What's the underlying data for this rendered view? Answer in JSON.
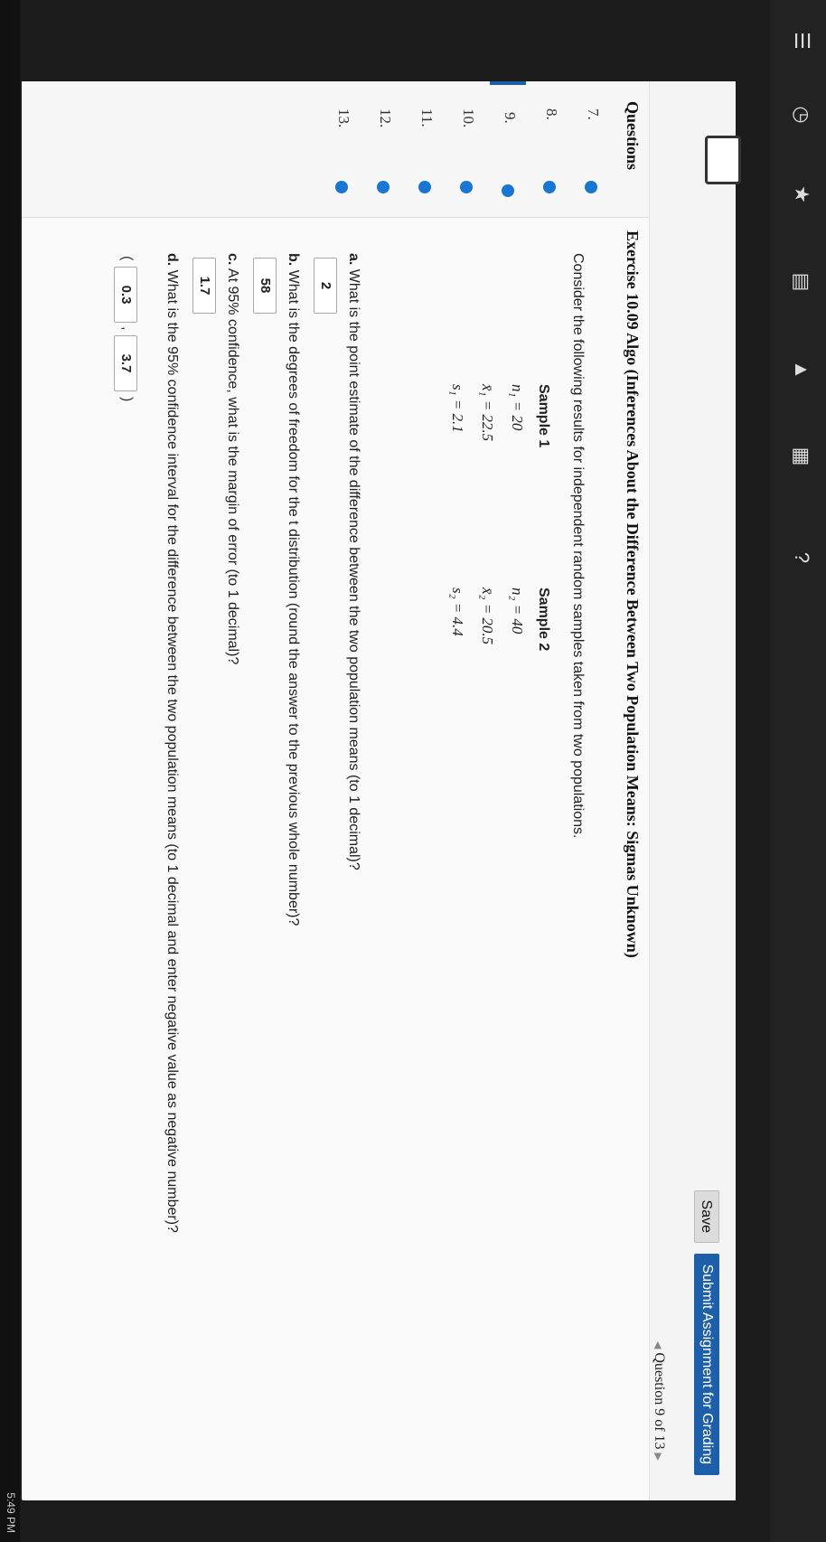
{
  "toolbar": {
    "save_label": "Save",
    "submit_label": "Submit Assignment for Grading",
    "question_nav": "Question 9 of 13"
  },
  "sidebar": {
    "title": "Questions",
    "items": [
      {
        "label": "7."
      },
      {
        "label": "8."
      },
      {
        "label": "9."
      },
      {
        "label": "10."
      },
      {
        "label": "11."
      },
      {
        "label": "12."
      },
      {
        "label": "13."
      }
    ]
  },
  "exercise": {
    "title": "Exercise 10.09 Algo (Inferences About the Difference Between Two Population Means: Sigmas Unknown)",
    "prompt": "Consider the following results for independent random samples taken from two populations.",
    "sample1": {
      "header": "Sample 1",
      "n": "n₁ = 20",
      "mean": "x̄₁ = 22.5",
      "s": "s₁ = 2.1"
    },
    "sample2": {
      "header": "Sample 2",
      "n": "n₂ = 40",
      "mean": "x̄₂ = 20.5",
      "s": "s₂ = 4.4"
    }
  },
  "parts": {
    "a": {
      "letter": "a.",
      "text": "What is the point estimate of the difference between the two population means (to 1 decimal)?",
      "answer": "2"
    },
    "b": {
      "letter": "b.",
      "text": "What is the degrees of freedom for the t distribution (round the answer to the previous whole number)?",
      "answer": "58"
    },
    "c": {
      "letter": "c.",
      "text": "At 95% confidence, what is the margin of error (to 1 decimal)?",
      "answer": "1.7"
    },
    "d": {
      "letter": "d.",
      "text": "What is the 95% confidence interval for the difference between the two population means (to 1 decimal and enter negative value as negative number)?",
      "lower": "0.3",
      "upper": "3.7",
      "open": "(",
      "comma": ",",
      "close": ")"
    }
  },
  "taskbar": {
    "time": "5:49 PM"
  },
  "colors": {
    "accent": "#1d5fa8",
    "dot": "#1976d2"
  }
}
